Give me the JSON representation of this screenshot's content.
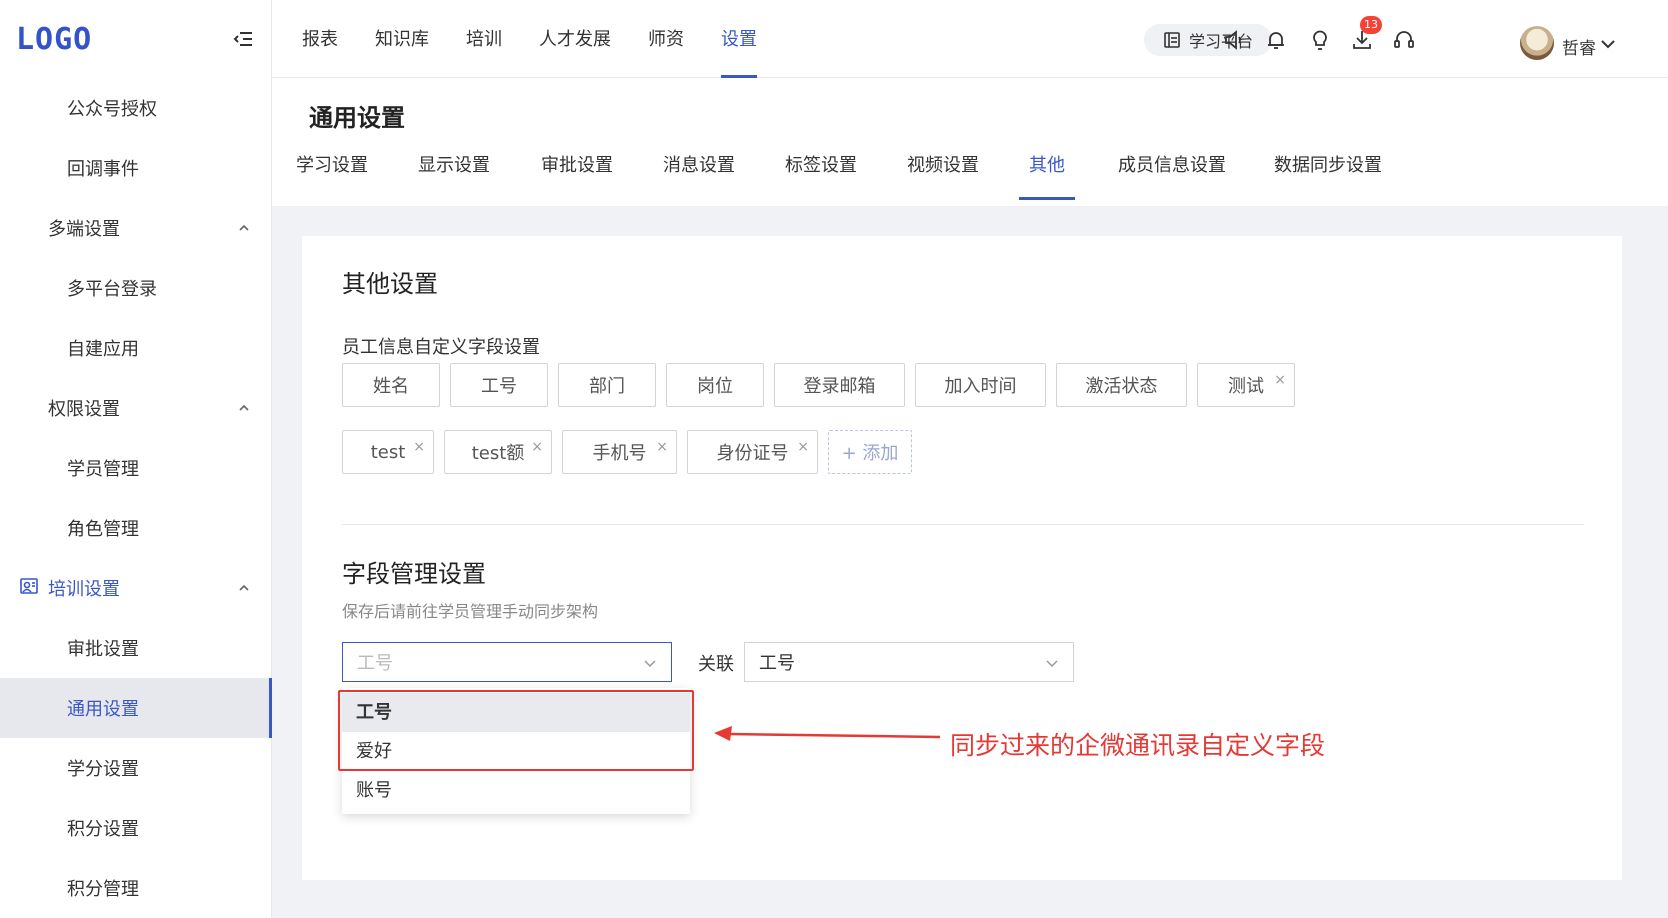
{
  "brand": {
    "logo": "LOGO"
  },
  "sidebar": {
    "items": [
      {
        "label": "公众号授权",
        "kind": "sub"
      },
      {
        "label": "回调事件",
        "kind": "sub"
      },
      {
        "label": "多端设置",
        "kind": "group"
      },
      {
        "label": "多平台登录",
        "kind": "sub"
      },
      {
        "label": "自建应用",
        "kind": "sub"
      },
      {
        "label": "权限设置",
        "kind": "group"
      },
      {
        "label": "学员管理",
        "kind": "sub"
      },
      {
        "label": "角色管理",
        "kind": "sub"
      },
      {
        "label": "培训设置",
        "kind": "group-active"
      },
      {
        "label": "审批设置",
        "kind": "sub"
      },
      {
        "label": "通用设置",
        "kind": "active"
      },
      {
        "label": "学分设置",
        "kind": "sub"
      },
      {
        "label": "积分设置",
        "kind": "sub"
      },
      {
        "label": "积分管理",
        "kind": "sub"
      }
    ]
  },
  "header": {
    "nav": [
      "报表",
      "知识库",
      "培训",
      "人才发展",
      "师资",
      "设置"
    ],
    "active_nav": "设置",
    "learn_platform": "学习平台",
    "notification_count": "13",
    "user_name": "哲睿",
    "icons": [
      "speaker-icon",
      "bell-icon",
      "bulb-icon",
      "download-icon",
      "headset-icon"
    ]
  },
  "page": {
    "title": "通用设置",
    "tabs": [
      "学习设置",
      "显示设置",
      "审批设置",
      "消息设置",
      "标签设置",
      "视频设置",
      "其他",
      "成员信息设置",
      "数据同步设置"
    ],
    "active_tab": "其他"
  },
  "other": {
    "title": "其他设置",
    "field_title": "员工信息自定义字段设置",
    "row1": [
      {
        "label": "姓名",
        "removable": false
      },
      {
        "label": "工号",
        "removable": false
      },
      {
        "label": "部门",
        "removable": false
      },
      {
        "label": "岗位",
        "removable": false
      },
      {
        "label": "登录邮箱",
        "removable": false
      },
      {
        "label": "加入时间",
        "removable": false
      },
      {
        "label": "激活状态",
        "removable": false
      },
      {
        "label": "测试",
        "removable": true
      }
    ],
    "row2": [
      {
        "label": "test",
        "removable": true
      },
      {
        "label": "test额",
        "removable": true
      },
      {
        "label": "手机号",
        "removable": true
      },
      {
        "label": "身份证号",
        "removable": true
      }
    ],
    "add_label": "+ 添加",
    "field_mgmt_title": "字段管理设置",
    "field_mgmt_desc": "保存后请前往学员管理手动同步架构",
    "select1_placeholder": "工号",
    "assoc_label": "关联",
    "select2_value": "工号",
    "dropdown_options": [
      "工号",
      "爱好",
      "账号"
    ],
    "dropdown_selected": "工号",
    "annotation": "同步过来的企微通讯录自定义字段"
  },
  "colors": {
    "accent": "#3a57c8",
    "annotation": "#e53935",
    "badge": "#f44336"
  }
}
